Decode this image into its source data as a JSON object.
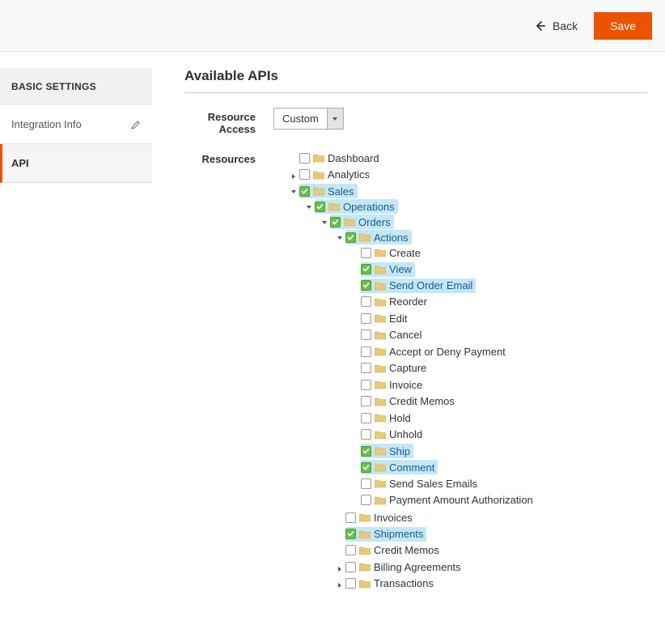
{
  "topbar": {
    "back": "Back",
    "save": "Save"
  },
  "sidebar": {
    "header": "BASIC SETTINGS",
    "items": [
      {
        "label": "Integration Info",
        "active": false,
        "editable": true
      },
      {
        "label": "API",
        "active": true,
        "editable": false
      }
    ]
  },
  "section": {
    "title": "Available APIs"
  },
  "fields": {
    "resource_access_label": "Resource Access",
    "resource_access_value": "Custom",
    "resources_label": "Resources"
  },
  "tree": [
    {
      "label": "Dashboard",
      "checked": false,
      "hl": false,
      "toggle": null,
      "depth": 0
    },
    {
      "label": "Analytics",
      "checked": false,
      "hl": false,
      "toggle": "closed",
      "depth": 0
    },
    {
      "label": "Sales",
      "checked": true,
      "hl": true,
      "toggle": "open",
      "depth": 0
    },
    {
      "label": "Operations",
      "checked": true,
      "hl": true,
      "toggle": "open",
      "depth": 1
    },
    {
      "label": "Orders",
      "checked": true,
      "hl": true,
      "toggle": "open",
      "depth": 2
    },
    {
      "label": "Actions",
      "checked": true,
      "hl": true,
      "toggle": "open",
      "depth": 3
    },
    {
      "label": "Create",
      "checked": false,
      "hl": false,
      "toggle": null,
      "depth": 4
    },
    {
      "label": "View",
      "checked": true,
      "hl": true,
      "toggle": null,
      "depth": 4
    },
    {
      "label": "Send Order Email",
      "checked": true,
      "hl": true,
      "toggle": null,
      "depth": 4
    },
    {
      "label": "Reorder",
      "checked": false,
      "hl": false,
      "toggle": null,
      "depth": 4
    },
    {
      "label": "Edit",
      "checked": false,
      "hl": false,
      "toggle": null,
      "depth": 4
    },
    {
      "label": "Cancel",
      "checked": false,
      "hl": false,
      "toggle": null,
      "depth": 4
    },
    {
      "label": "Accept or Deny Payment",
      "checked": false,
      "hl": false,
      "toggle": null,
      "depth": 4
    },
    {
      "label": "Capture",
      "checked": false,
      "hl": false,
      "toggle": null,
      "depth": 4
    },
    {
      "label": "Invoice",
      "checked": false,
      "hl": false,
      "toggle": null,
      "depth": 4
    },
    {
      "label": "Credit Memos",
      "checked": false,
      "hl": false,
      "toggle": null,
      "depth": 4
    },
    {
      "label": "Hold",
      "checked": false,
      "hl": false,
      "toggle": null,
      "depth": 4
    },
    {
      "label": "Unhold",
      "checked": false,
      "hl": false,
      "toggle": null,
      "depth": 4
    },
    {
      "label": "Ship",
      "checked": true,
      "hl": true,
      "toggle": null,
      "depth": 4
    },
    {
      "label": "Comment",
      "checked": true,
      "hl": true,
      "toggle": null,
      "depth": 4
    },
    {
      "label": "Send Sales Emails",
      "checked": false,
      "hl": false,
      "toggle": null,
      "depth": 4
    },
    {
      "label": "Payment Amount Authorization",
      "checked": false,
      "hl": false,
      "toggle": null,
      "depth": 4
    },
    {
      "label": "Invoices",
      "checked": false,
      "hl": false,
      "toggle": null,
      "depth": 3
    },
    {
      "label": "Shipments",
      "checked": true,
      "hl": true,
      "toggle": null,
      "depth": 3
    },
    {
      "label": "Credit Memos",
      "checked": false,
      "hl": false,
      "toggle": null,
      "depth": 3
    },
    {
      "label": "Billing Agreements",
      "checked": false,
      "hl": false,
      "toggle": "closed",
      "depth": 3
    },
    {
      "label": "Transactions",
      "checked": false,
      "hl": false,
      "toggle": "closed",
      "depth": 3
    }
  ]
}
